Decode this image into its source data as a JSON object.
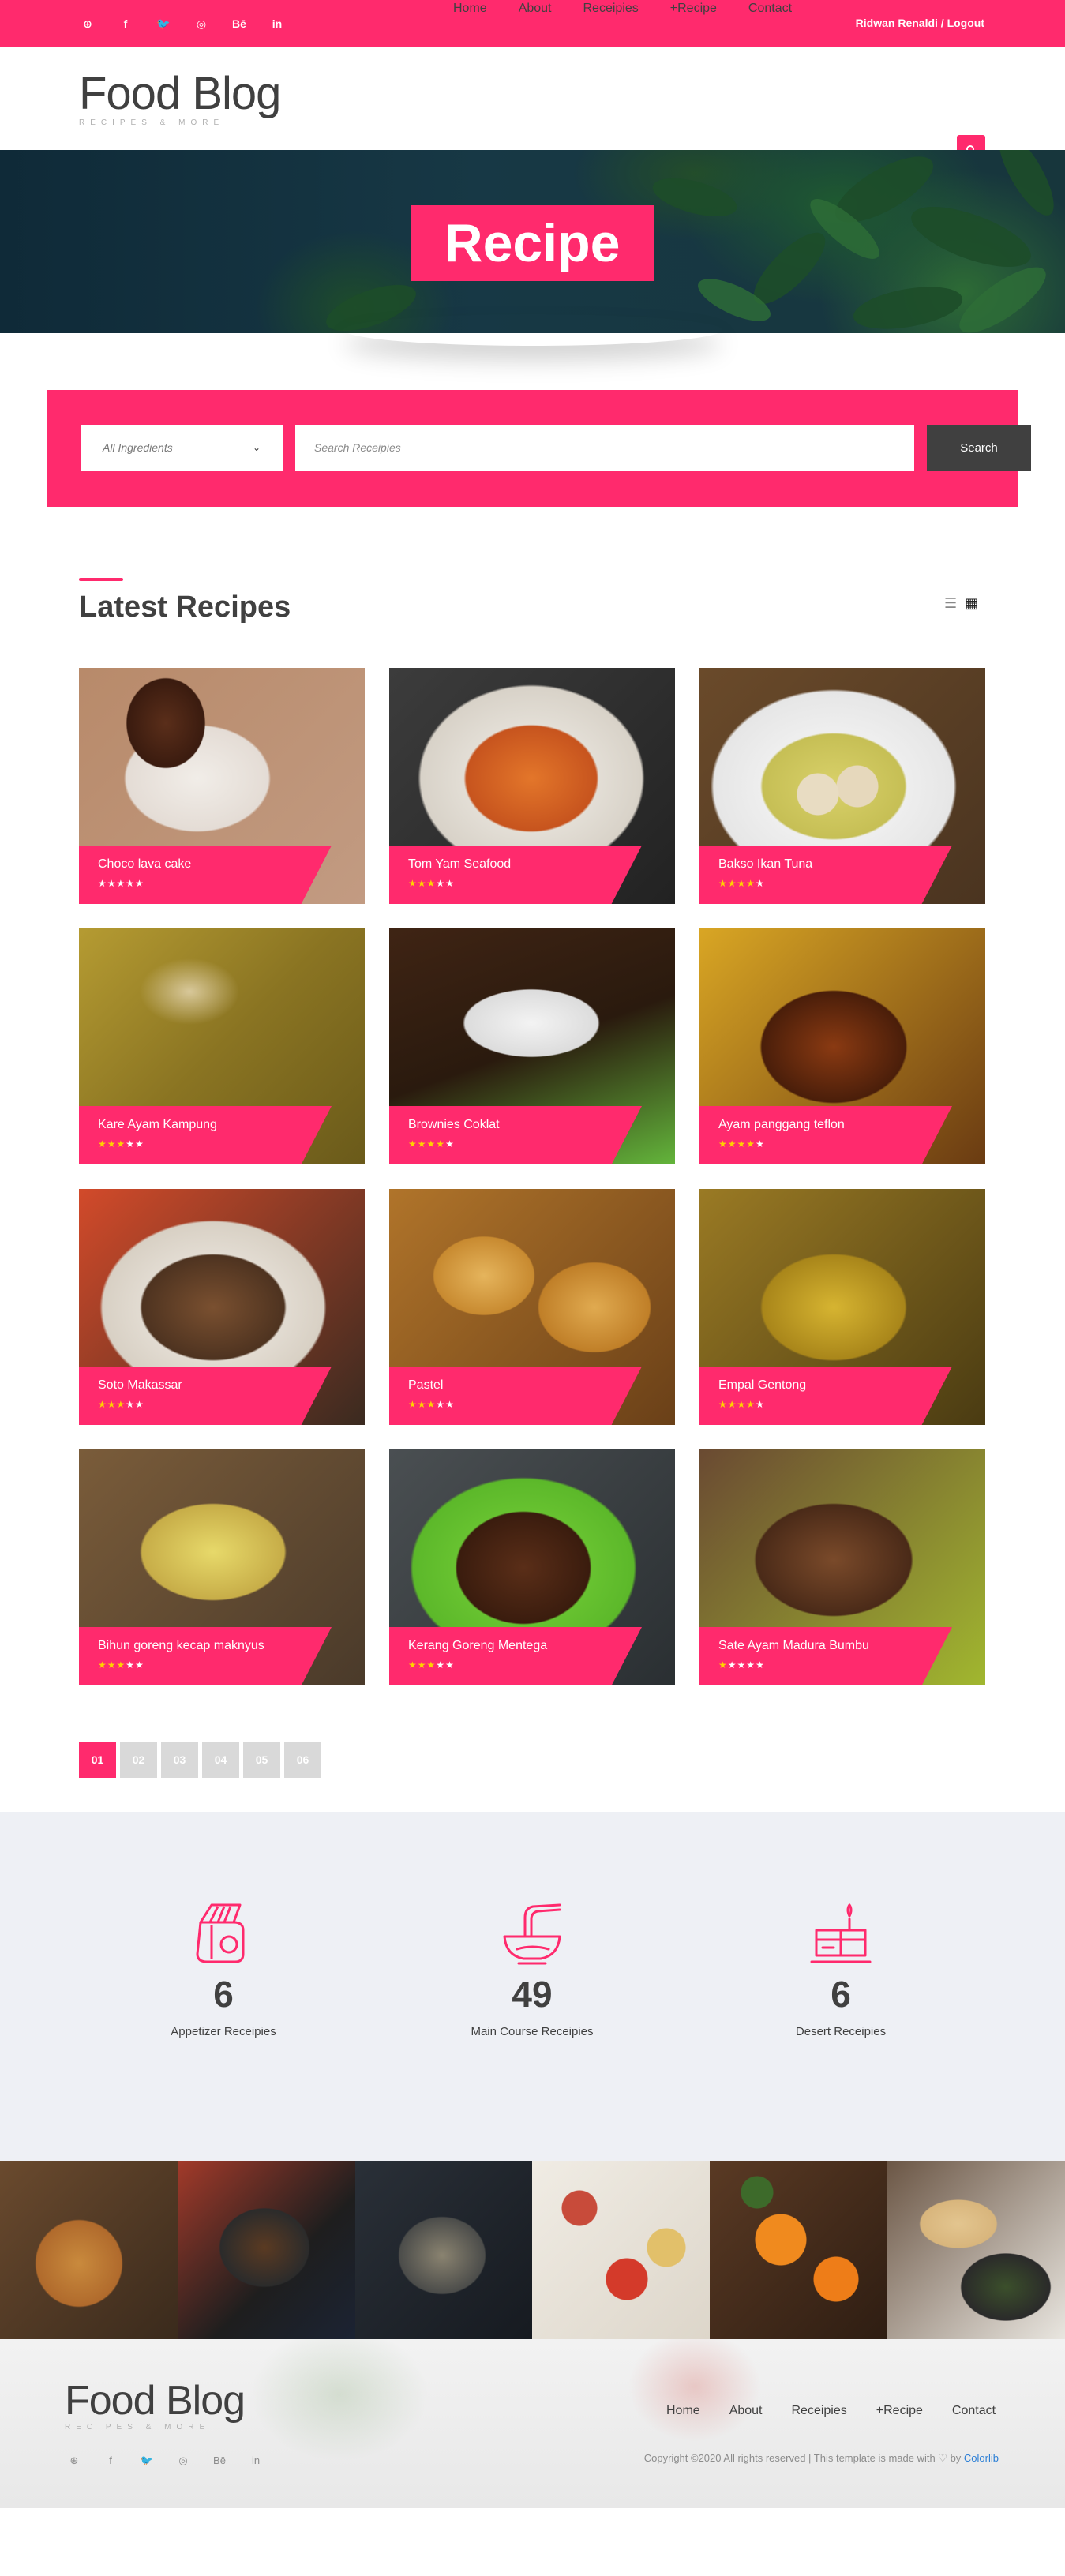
{
  "topbar": {
    "social": [
      {
        "icon": "pinterest-icon",
        "glyph": "⊕"
      },
      {
        "icon": "facebook-icon",
        "glyph": "f"
      },
      {
        "icon": "twitter-icon",
        "glyph": "🐦"
      },
      {
        "icon": "dribbble-icon",
        "glyph": "◎"
      },
      {
        "icon": "behance-icon",
        "glyph": "Bē"
      },
      {
        "icon": "linkedin-icon",
        "glyph": "in"
      }
    ],
    "user_link": "Ridwan Renaldi / Logout"
  },
  "header": {
    "logo_title": "Food Blog",
    "logo_sub": "RECIPES & MORE",
    "nav": [
      "Home",
      "About",
      "Receipies",
      "+Recipe",
      "Contact"
    ],
    "search_glyph": "🔍"
  },
  "hero": {
    "title": "Recipe"
  },
  "search": {
    "select_value": "All Ingredients",
    "input_placeholder": "Search Receipies",
    "button": "Search"
  },
  "latest": {
    "title": "Latest Recipes",
    "list_glyph": "☰",
    "grid_glyph": "▦"
  },
  "recipes": [
    {
      "title": "Choco lava cake",
      "rating": 0,
      "img": "choco"
    },
    {
      "title": "Tom Yam Seafood",
      "rating": 3,
      "img": "tomyam"
    },
    {
      "title": "Bakso Ikan Tuna",
      "rating": 4,
      "img": "bakso"
    },
    {
      "title": "Kare Ayam Kampung",
      "rating": 3,
      "img": "kare"
    },
    {
      "title": "Brownies Coklat",
      "rating": 4,
      "img": "brownies"
    },
    {
      "title": "Ayam panggang teflon",
      "rating": 4,
      "img": "ayam"
    },
    {
      "title": "Soto Makassar",
      "rating": 3,
      "img": "soto"
    },
    {
      "title": "Pastel",
      "rating": 3,
      "img": "pastel"
    },
    {
      "title": "Empal Gentong",
      "rating": 4,
      "img": "empal"
    },
    {
      "title": "Bihun goreng kecap maknyus",
      "rating": 3,
      "img": "bihun"
    },
    {
      "title": "Kerang Goreng Mentega",
      "rating": 3,
      "img": "kerang"
    },
    {
      "title": "Sate Ayam Madura Bumbu",
      "rating": 1,
      "img": "sate"
    }
  ],
  "pagination": [
    "01",
    "02",
    "03",
    "04",
    "05",
    "06"
  ],
  "stats": [
    {
      "icon": "bread-icon",
      "number": "6",
      "label": "Appetizer Receipies"
    },
    {
      "icon": "noodle-bowl-icon",
      "number": "49",
      "label": "Main Course Receipies"
    },
    {
      "icon": "cake-icon",
      "number": "6",
      "label": "Desert Receipies"
    }
  ],
  "footer": {
    "logo_title": "Food Blog",
    "logo_sub": "RECIPES & MORE",
    "nav": [
      "Home",
      "About",
      "Receipies",
      "+Recipe",
      "Contact"
    ],
    "copyright": "Copyright ©2020 All rights reserved | This template is made with ♡ by ",
    "copyright_link": "Colorlib"
  },
  "colors": {
    "accent": "#ff2a6d",
    "dark": "#404040",
    "light_bg": "#eef0f5",
    "star": "#ffd200"
  }
}
